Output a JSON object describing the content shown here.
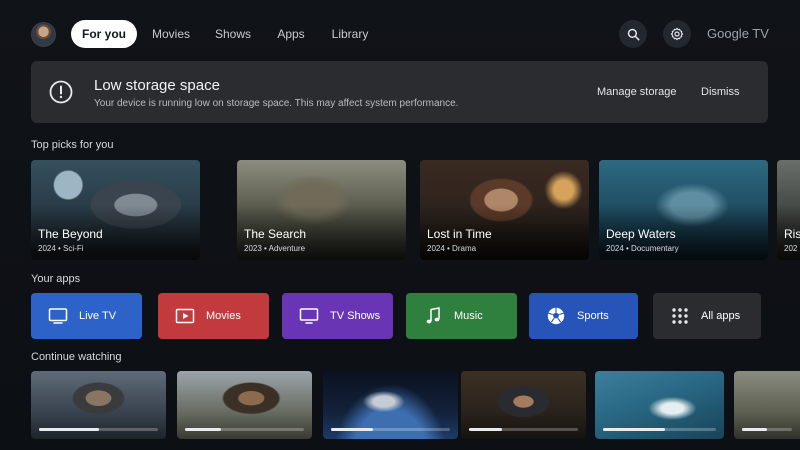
{
  "nav": {
    "tabs": [
      {
        "label": "For you",
        "active": true
      },
      {
        "label": "Movies",
        "active": false
      },
      {
        "label": "Shows",
        "active": false
      },
      {
        "label": "Apps",
        "active": false
      },
      {
        "label": "Library",
        "active": false
      }
    ],
    "search_icon": "search-icon",
    "settings_icon": "gear-icon",
    "brand": "Google TV"
  },
  "banner": {
    "title": "Low storage space",
    "message": "Your device is running low on storage space. This may affect system performance.",
    "manage_label": "Manage storage",
    "dismiss_label": "Dismiss",
    "icon": "alert-circle-icon"
  },
  "top_picks": {
    "heading": "Top picks for you",
    "items": [
      {
        "title": "The Beyond",
        "year": "2024",
        "genre": "Sci-Fi"
      },
      {
        "title": "The Search",
        "year": "2023",
        "genre": "Adventure"
      },
      {
        "title": "Lost in Time",
        "year": "2024",
        "genre": "Drama"
      },
      {
        "title": "Deep Waters",
        "year": "2024",
        "genre": "Documentary"
      },
      {
        "title": "Risi",
        "year": "202",
        "genre": ""
      }
    ]
  },
  "apps": {
    "heading": "Your apps",
    "items": [
      {
        "label": "Live TV",
        "icon": "tv-icon",
        "color": "#2d63c8"
      },
      {
        "label": "Movies",
        "icon": "play-icon",
        "color": "#c33a3e"
      },
      {
        "label": "TV Shows",
        "icon": "monitor-icon",
        "color": "#6a35b4"
      },
      {
        "label": "Music",
        "icon": "music-note-icon",
        "color": "#2f7f3f"
      },
      {
        "label": "Sports",
        "icon": "soccer-ball-icon",
        "color": "#2654b9"
      },
      {
        "label": "All apps",
        "icon": "grid-icon",
        "color": "#2a2c30"
      }
    ]
  },
  "continue_watching": {
    "heading": "Continue watching",
    "items": [
      {
        "progress": 0.5
      },
      {
        "progress": 0.3
      },
      {
        "progress": 0.35
      },
      {
        "progress": 0.3
      },
      {
        "progress": 0.55
      },
      {
        "progress": 0.5
      }
    ]
  }
}
